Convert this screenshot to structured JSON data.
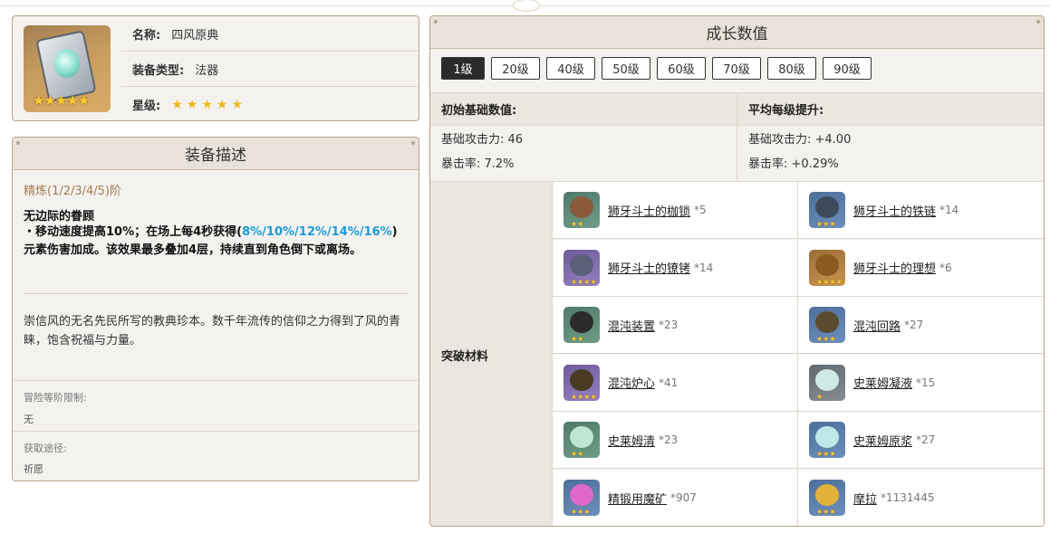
{
  "info": {
    "name_label": "名称:",
    "name": "四风原典",
    "type_label": "装备类型:",
    "type": "法器",
    "rarity_label": "星级:",
    "rarity": 5
  },
  "description": {
    "header": "装备描述",
    "refine_title": "精炼(1/2/3/4/5)阶",
    "passive_name": "无边际的眷顾",
    "passive_line1_pre": "・移动速度提高10%；在场上每4秒获得(",
    "passive_line1_values": "8%/10%/12%/14%/16%",
    "passive_line1_post": ")",
    "passive_line2": "元素伤害加成。该效果最多叠加4层，持续直到角色倒下或离场。",
    "lore": "崇信风的无名先民所写的教典珍本。数千年流传的信仰之力得到了风的青睐，饱含祝福与力量。",
    "ar_limit_label": "冒险等阶限制:",
    "ar_limit_value": "无",
    "source_label": "获取途径:",
    "source_value": "祈愿"
  },
  "growth": {
    "header": "成长数值",
    "levels": [
      "1级",
      "20级",
      "40级",
      "50级",
      "60级",
      "70级",
      "80级",
      "90级"
    ],
    "active_level": "1级",
    "base_header": "初始基础数值:",
    "avg_header": "平均每级提升:",
    "base_atk": "基础攻击力: 46",
    "base_crit": "暴击率: 7.2%",
    "avg_atk": "基础攻击力: +4.00",
    "avg_crit": "暴击率: +0.29%",
    "materials_label": "突破材料",
    "materials": [
      {
        "name": "狮牙斗士的枷锁",
        "count": "*5",
        "rarity": 2,
        "icon": "shackle-icon"
      },
      {
        "name": "狮牙斗士的铁链",
        "count": "*14",
        "rarity": 3,
        "icon": "iron-chain-icon"
      },
      {
        "name": "狮牙斗士的镣铐",
        "count": "*14",
        "rarity": 4,
        "icon": "fetters-icon"
      },
      {
        "name": "狮牙斗士的理想",
        "count": "*6",
        "rarity": 5,
        "icon": "ideal-icon"
      },
      {
        "name": "混沌装置",
        "count": "*23",
        "rarity": 2,
        "icon": "chaos-device-icon"
      },
      {
        "name": "混沌回路",
        "count": "*27",
        "rarity": 3,
        "icon": "chaos-circuit-icon"
      },
      {
        "name": "混沌炉心",
        "count": "*41",
        "rarity": 4,
        "icon": "chaos-core-icon"
      },
      {
        "name": "史莱姆凝液",
        "count": "*15",
        "rarity": 1,
        "icon": "slime-condensate-icon"
      },
      {
        "name": "史莱姆清",
        "count": "*23",
        "rarity": 2,
        "icon": "slime-secretions-icon"
      },
      {
        "name": "史莱姆原浆",
        "count": "*27",
        "rarity": 3,
        "icon": "slime-concentrate-icon"
      },
      {
        "name": "精锻用魔矿",
        "count": "*907",
        "rarity": 3,
        "icon": "mystic-ore-icon"
      },
      {
        "name": "摩拉",
        "count": "*1131445",
        "rarity": 3,
        "icon": "mora-icon"
      }
    ]
  }
}
